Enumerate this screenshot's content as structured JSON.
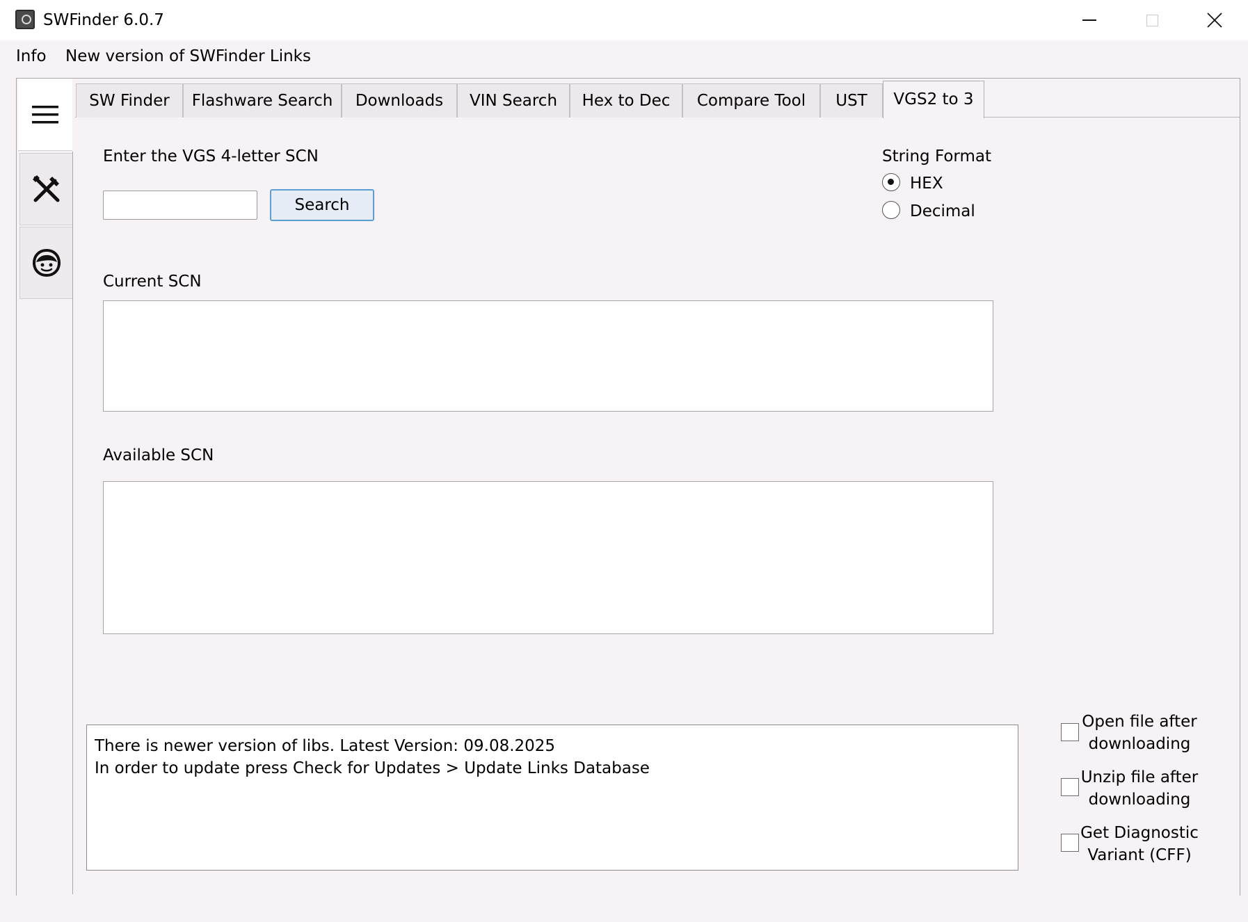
{
  "window": {
    "title": "SWFinder 6.0.7"
  },
  "menu": {
    "items": [
      "Info",
      "New version of SWFinder Links"
    ]
  },
  "tabs": [
    {
      "label": "SW Finder",
      "active": false
    },
    {
      "label": "Flashware Search",
      "active": false
    },
    {
      "label": "Downloads",
      "active": false
    },
    {
      "label": "VIN Search",
      "active": false
    },
    {
      "label": "Hex to Dec",
      "active": false
    },
    {
      "label": "Compare Tool",
      "active": false
    },
    {
      "label": "UST",
      "active": false
    },
    {
      "label": "VGS2 to 3",
      "active": true
    }
  ],
  "sidebar": {
    "icons": [
      "hamburger-menu-icon",
      "tools-icon",
      "support-face-icon"
    ]
  },
  "vgs": {
    "scn_label": "Enter the VGS 4-letter SCN",
    "scn_value": "",
    "search_label": "Search",
    "string_format_label": "String Format",
    "formats": [
      {
        "label": "HEX",
        "selected": true
      },
      {
        "label": "Decimal",
        "selected": false
      }
    ],
    "current_scn_label": "Current SCN",
    "current_scn_value": "",
    "available_scn_label": "Available SCN",
    "available_scn_value": ""
  },
  "log": {
    "lines": [
      "There is newer version of libs. Latest Version: 09.08.2025",
      "In order to update press Check for Updates > Update Links Database"
    ]
  },
  "options": [
    {
      "line1": "Open file after",
      "line2": "downloading",
      "checked": false
    },
    {
      "line1": "Unzip file after",
      "line2": "downloading",
      "checked": false
    },
    {
      "line1": "Get Diagnostic",
      "line2": "Variant (CFF)",
      "checked": false
    }
  ]
}
